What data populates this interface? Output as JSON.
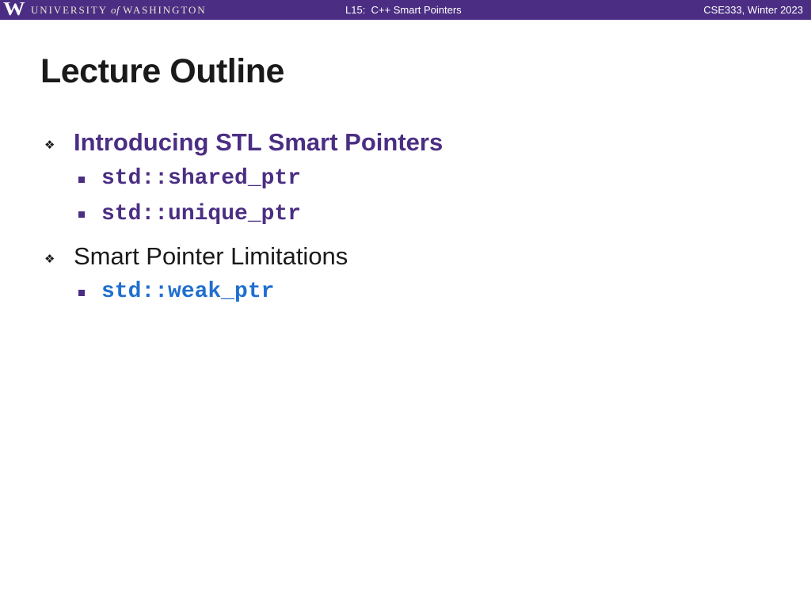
{
  "header": {
    "logo_text": "UNIVERSITY of WASHINGTON",
    "logo_university": "UNIVERSITY",
    "logo_of": "of",
    "logo_washington": "WASHINGTON",
    "lecture": "L15:  C++ Smart Pointers",
    "course": "CSE333, Winter 2023",
    "bar_color": "#4b2e83"
  },
  "slide": {
    "title": "Lecture Outline",
    "items": [
      {
        "label": "Introducing STL Smart Pointers",
        "active": true,
        "bullet_icon": "diamond-cluster-icon",
        "subitems": [
          {
            "label": "std::shared_ptr",
            "color": "#4b2e83",
            "bullet_icon": "square-bullet-icon"
          },
          {
            "label": "std::unique_ptr",
            "color": "#4b2e83",
            "bullet_icon": "square-bullet-icon"
          }
        ]
      },
      {
        "label": "Smart Pointer Limitations",
        "active": false,
        "bullet_icon": "diamond-cluster-icon",
        "subitems": [
          {
            "label": "std::weak_ptr",
            "color": "#1f6fd0",
            "bullet_icon": "square-bullet-icon"
          }
        ]
      }
    ]
  }
}
